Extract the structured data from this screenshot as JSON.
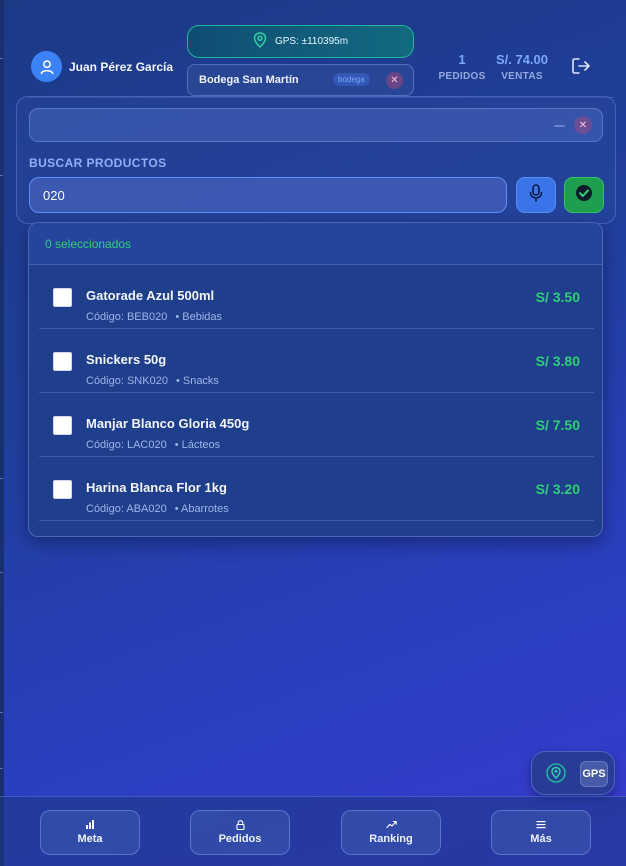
{
  "header": {
    "user_name": "Juan Pérez García",
    "gps_label": "GPS: ±110395m",
    "store_name": "Bodega San Martín",
    "store_tag": "bodega",
    "close_symbol": "✕",
    "stats": {
      "orders_value": "1",
      "orders_label": "PEDIDOS",
      "sales_value": "S/. 74.00",
      "sales_label": "VENTAS"
    }
  },
  "search": {
    "top_clear_symbol": "✕",
    "label": "BUSCAR PRODUCTOS",
    "query": "020"
  },
  "results": {
    "selected_count": "0 seleccionados",
    "products": [
      {
        "name": "Gatorade Azul 500ml",
        "code": "Código: BEB020",
        "category": "• Bebidas",
        "price": "S/ 3.50",
        "checked": false
      },
      {
        "name": "Snickers 50g",
        "code": "Código: SNK020",
        "category": "• Snacks",
        "price": "S/ 3.80",
        "checked": false
      },
      {
        "name": "Manjar Blanco Gloria 450g",
        "code": "Código: LAC020",
        "category": "• Lácteos",
        "price": "S/ 7.50",
        "checked": false
      },
      {
        "name": "Harina Blanca Flor 1kg",
        "code": "Código: ABA020",
        "category": "• Abarrotes",
        "price": "S/ 3.20",
        "checked": false
      }
    ]
  },
  "gps_float": {
    "label": "GPS"
  },
  "bottom_nav": [
    {
      "label": "Meta",
      "icon": "bar-chart-icon"
    },
    {
      "label": "Pedidos",
      "icon": "lock-icon"
    },
    {
      "label": "Ranking",
      "icon": "trend-icon"
    },
    {
      "label": "Más",
      "icon": "menu-icon"
    }
  ],
  "colors": {
    "accent_blue": "#3b82f6",
    "success_green": "#2bd176",
    "gps_teal": "#1fb59a"
  }
}
